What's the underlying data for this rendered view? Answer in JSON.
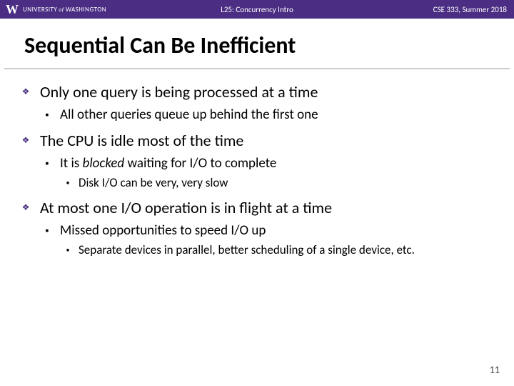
{
  "header": {
    "university_prefix": "UNIVERSITY",
    "university_of": "of",
    "university_name": "WASHINGTON",
    "lecture": "L25: Concurrency Intro",
    "course": "CSE 333, Summer 2018"
  },
  "title": "Sequential Can Be Inefficient",
  "b1": {
    "text": "Only one query is being processed at a time",
    "sub1": "All other queries queue up behind the first one"
  },
  "b2": {
    "text": "The CPU is idle most of the time",
    "sub1_prefix": "It is ",
    "sub1_italic": "blocked",
    "sub1_suffix": " waiting for I/O to complete",
    "sub1a": "Disk I/O can be very, very slow"
  },
  "b3": {
    "text": "At most one I/O operation is in flight at a time",
    "sub1": "Missed opportunities to speed I/O up",
    "sub1a": "Separate devices in parallel, better scheduling of a single device, etc."
  },
  "page_number": "11"
}
